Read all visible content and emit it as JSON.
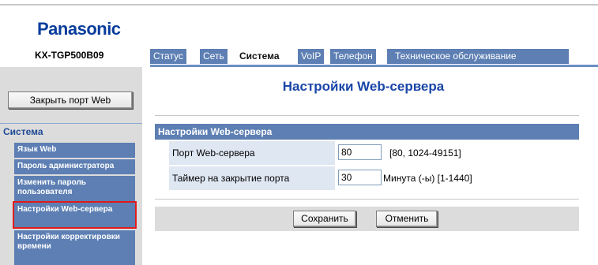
{
  "header": {
    "brand": "Panasonic",
    "model": "KX-TGP500B09"
  },
  "tabs": [
    {
      "label": "Статус",
      "active": false
    },
    {
      "label": "Сеть",
      "active": false
    },
    {
      "label": "Система",
      "active": true
    },
    {
      "label": "VoIP",
      "active": false
    },
    {
      "label": "Телефон",
      "active": false
    },
    {
      "label": "Техническое обслуживание",
      "active": false
    }
  ],
  "sidebar": {
    "close_button": "Закрыть порт Web",
    "section_title": "Система",
    "items": [
      {
        "label": "Язык Web"
      },
      {
        "label": "Пароль администратора"
      },
      {
        "label": "Изменить пароль пользователя"
      },
      {
        "label": "Настройки Web-сервера",
        "selected": true
      },
      {
        "label": "Настройки корректировки времени"
      }
    ]
  },
  "main": {
    "title": "Настройки Web-сервера",
    "section_title": "Настройки Web-сервера",
    "fields": [
      {
        "label": "Порт Web-сервера",
        "value": "80",
        "hint": "[80, 1024-49151]"
      },
      {
        "label": "Таймер на закрытие порта",
        "value": "30",
        "hint": "Минута (-ы) [1-1440]"
      }
    ],
    "save_label": "Сохранить",
    "cancel_label": "Отменить"
  },
  "colors": {
    "brand": "#0a3d9c",
    "tab_bg": "#5d7fb3",
    "title": "#1a46a8",
    "selected_outline": "#e21a1a"
  }
}
